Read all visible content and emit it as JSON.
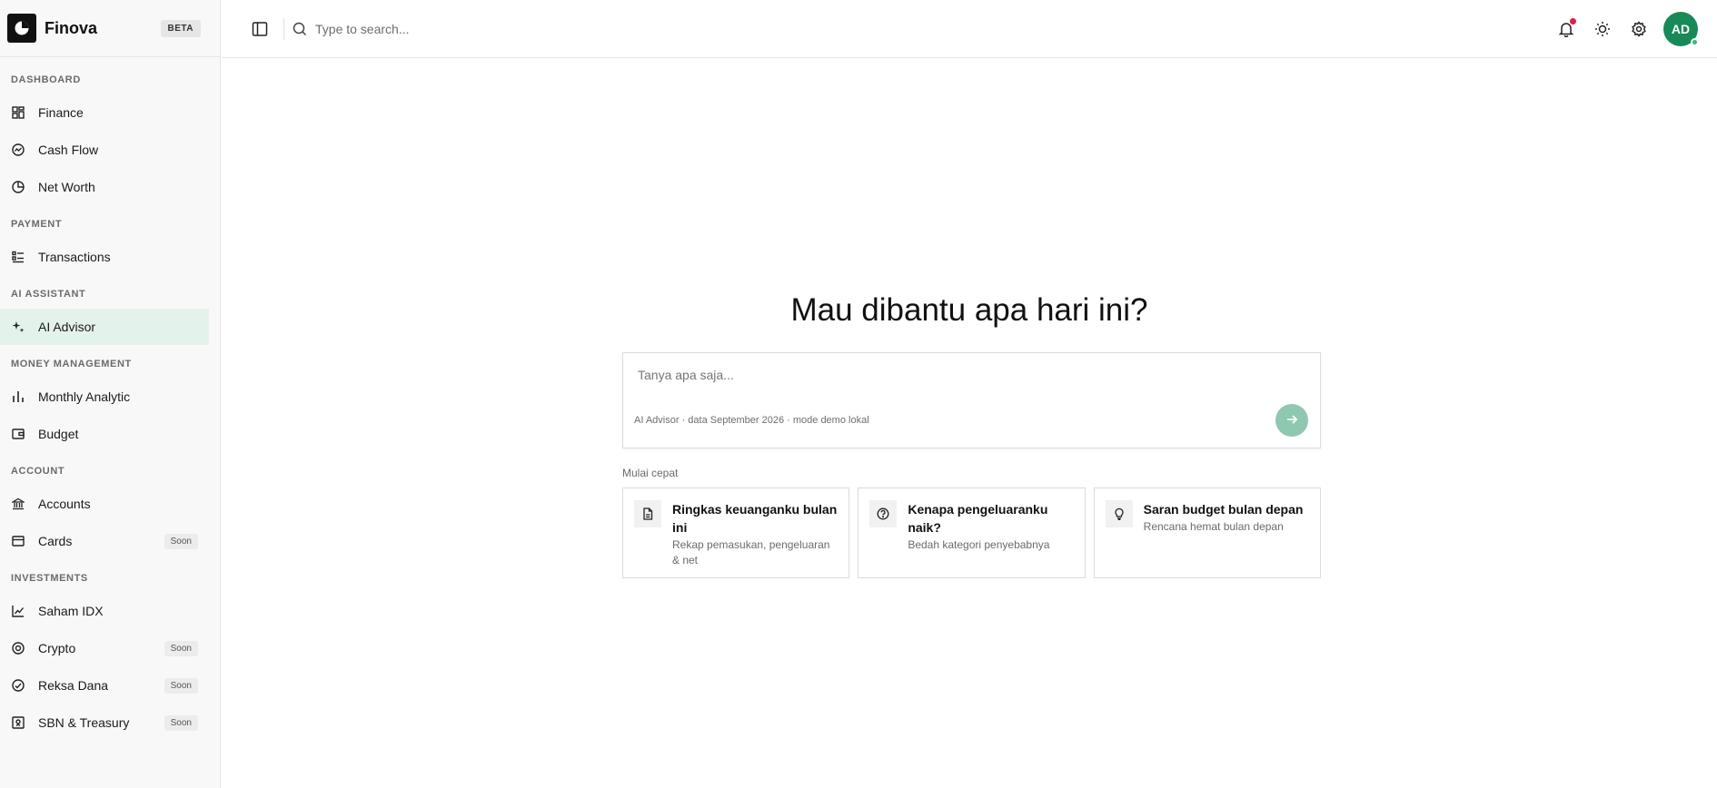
{
  "brand": {
    "name": "Finova",
    "badge": "BETA"
  },
  "sidebar": {
    "sections": [
      {
        "label": "DASHBOARD",
        "items": [
          {
            "label": "Finance",
            "icon": "grid-icon"
          },
          {
            "label": "Cash Flow",
            "icon": "gauge-icon"
          },
          {
            "label": "Net Worth",
            "icon": "pie-icon"
          }
        ]
      },
      {
        "label": "PAYMENT",
        "items": [
          {
            "label": "Transactions",
            "icon": "list-icon"
          }
        ]
      },
      {
        "label": "AI ASSISTANT",
        "items": [
          {
            "label": "AI Advisor",
            "icon": "sparkles-icon",
            "active": true
          }
        ]
      },
      {
        "label": "MONEY MANAGEMENT",
        "items": [
          {
            "label": "Monthly Analytic",
            "icon": "bar-chart-icon"
          },
          {
            "label": "Budget",
            "icon": "wallet-icon"
          }
        ]
      },
      {
        "label": "ACCOUNT",
        "items": [
          {
            "label": "Accounts",
            "icon": "bank-icon"
          },
          {
            "label": "Cards",
            "icon": "card-icon",
            "badge": "Soon"
          }
        ]
      },
      {
        "label": "INVESTMENTS",
        "items": [
          {
            "label": "Saham IDX",
            "icon": "line-chart-icon"
          },
          {
            "label": "Crypto",
            "icon": "coin-icon",
            "badge": "Soon"
          },
          {
            "label": "Reksa Dana",
            "icon": "check-circle-icon",
            "badge": "Soon"
          },
          {
            "label": "SBN & Treasury",
            "icon": "certificate-icon",
            "badge": "Soon"
          }
        ]
      }
    ]
  },
  "topbar": {
    "search_placeholder": "Type to search...",
    "avatar_initials": "AD",
    "has_notification": true
  },
  "main": {
    "heading": "Mau dibantu apa hari ini?",
    "composer": {
      "placeholder": "Tanya apa saja...",
      "meta": "AI Advisor · data September 2026 · mode demo lokal"
    },
    "quick_label": "Mulai cepat",
    "quick_cards": [
      {
        "title": "Ringkas keuanganku bulan ini",
        "subtitle": "Rekap pemasukan, pengeluaran & net",
        "icon": "document-icon"
      },
      {
        "title": "Kenapa pengeluaranku naik?",
        "subtitle": "Bedah kategori penyebabnya",
        "icon": "question-icon"
      },
      {
        "title": "Saran budget bulan depan",
        "subtitle": "Rencana hemat bulan depan",
        "icon": "lightbulb-icon"
      }
    ]
  },
  "colors": {
    "accent": "#178a58",
    "active_bg": "#e3f3ec",
    "send_button": "#8fc8b0",
    "notification": "#e11d48"
  }
}
